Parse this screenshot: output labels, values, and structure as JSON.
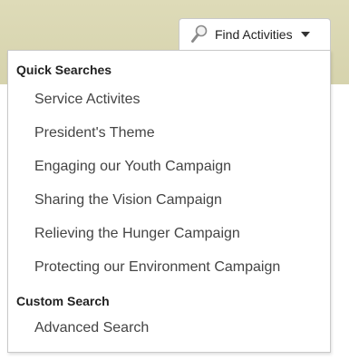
{
  "header": {
    "find_button_label": "Find Activities",
    "find_button_icon": "search-icon",
    "caret_icon": "chevron-down-icon"
  },
  "menu": {
    "quick_searches": {
      "title": "Quick Searches",
      "items": [
        "Service Activites",
        "President's Theme",
        "Engaging our Youth Campaign",
        "Sharing the Vision Campaign",
        "Relieving the Hunger Campaign",
        "Protecting our Environment Campaign"
      ]
    },
    "custom_search": {
      "title": "Custom Search",
      "items": [
        "Advanced Search"
      ]
    }
  },
  "colors": {
    "header_bar": "#d8d5b0",
    "menu_text": "#444444",
    "header_text": "#222222"
  }
}
